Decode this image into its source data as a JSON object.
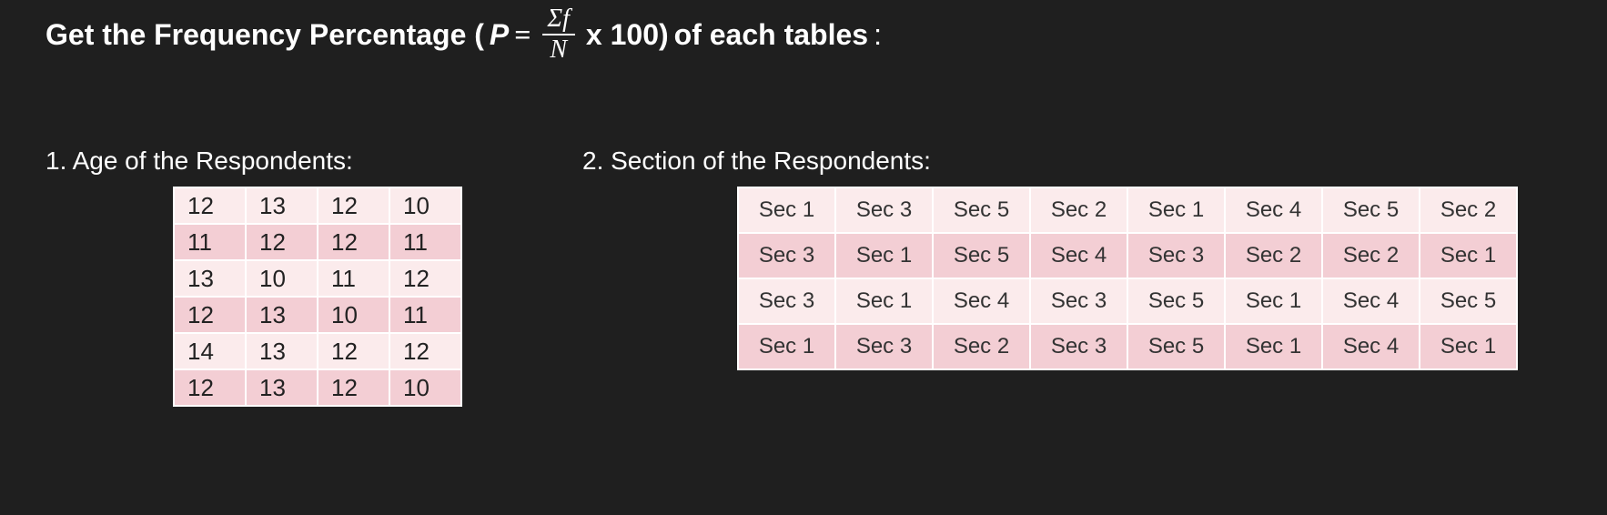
{
  "heading": {
    "prefix": "Get the Frequency Percentage (",
    "pvar": "P",
    "equals": "=",
    "numerator": "Σf",
    "denominator": "N",
    "times": "x 100)",
    "suffix1": " of each tables",
    "suffix2": ":"
  },
  "table1": {
    "title": "1. Age of the Respondents:",
    "rows": [
      [
        "12",
        "13",
        "12",
        "10"
      ],
      [
        "11",
        "12",
        "12",
        "11"
      ],
      [
        "13",
        "10",
        "11",
        "12"
      ],
      [
        "12",
        "13",
        "10",
        "11"
      ],
      [
        "14",
        "13",
        "12",
        "12"
      ],
      [
        "12",
        "13",
        "12",
        "10"
      ]
    ]
  },
  "table2": {
    "title": "2. Section of the Respondents:",
    "rows": [
      [
        "Sec 1",
        "Sec 3",
        "Sec 5",
        "Sec 2",
        "Sec 1",
        "Sec 4",
        "Sec 5",
        "Sec 2"
      ],
      [
        "Sec 3",
        "Sec 1",
        "Sec 5",
        "Sec 4",
        "Sec 3",
        "Sec 2",
        "Sec 2",
        "Sec 1"
      ],
      [
        "Sec 3",
        "Sec 1",
        "Sec 4",
        "Sec 3",
        "Sec 5",
        "Sec 1",
        "Sec 4",
        "Sec 5"
      ],
      [
        "Sec 1",
        "Sec 3",
        "Sec 2",
        "Sec 3",
        "Sec 5",
        "Sec 1",
        "Sec 4",
        "Sec 1"
      ]
    ]
  },
  "chart_data": [
    {
      "type": "table",
      "title": "Age of the Respondents",
      "values": [
        12,
        13,
        12,
        10,
        11,
        12,
        12,
        11,
        13,
        10,
        11,
        12,
        12,
        13,
        10,
        11,
        14,
        13,
        12,
        12,
        12,
        13,
        12,
        10
      ]
    },
    {
      "type": "table",
      "title": "Section of the Respondents",
      "values": [
        "Sec 1",
        "Sec 3",
        "Sec 5",
        "Sec 2",
        "Sec 1",
        "Sec 4",
        "Sec 5",
        "Sec 2",
        "Sec 3",
        "Sec 1",
        "Sec 5",
        "Sec 4",
        "Sec 3",
        "Sec 2",
        "Sec 2",
        "Sec 1",
        "Sec 3",
        "Sec 1",
        "Sec 4",
        "Sec 3",
        "Sec 5",
        "Sec 1",
        "Sec 4",
        "Sec 5",
        "Sec 1",
        "Sec 3",
        "Sec 2",
        "Sec 3",
        "Sec 5",
        "Sec 1",
        "Sec 4",
        "Sec 1"
      ]
    }
  ]
}
